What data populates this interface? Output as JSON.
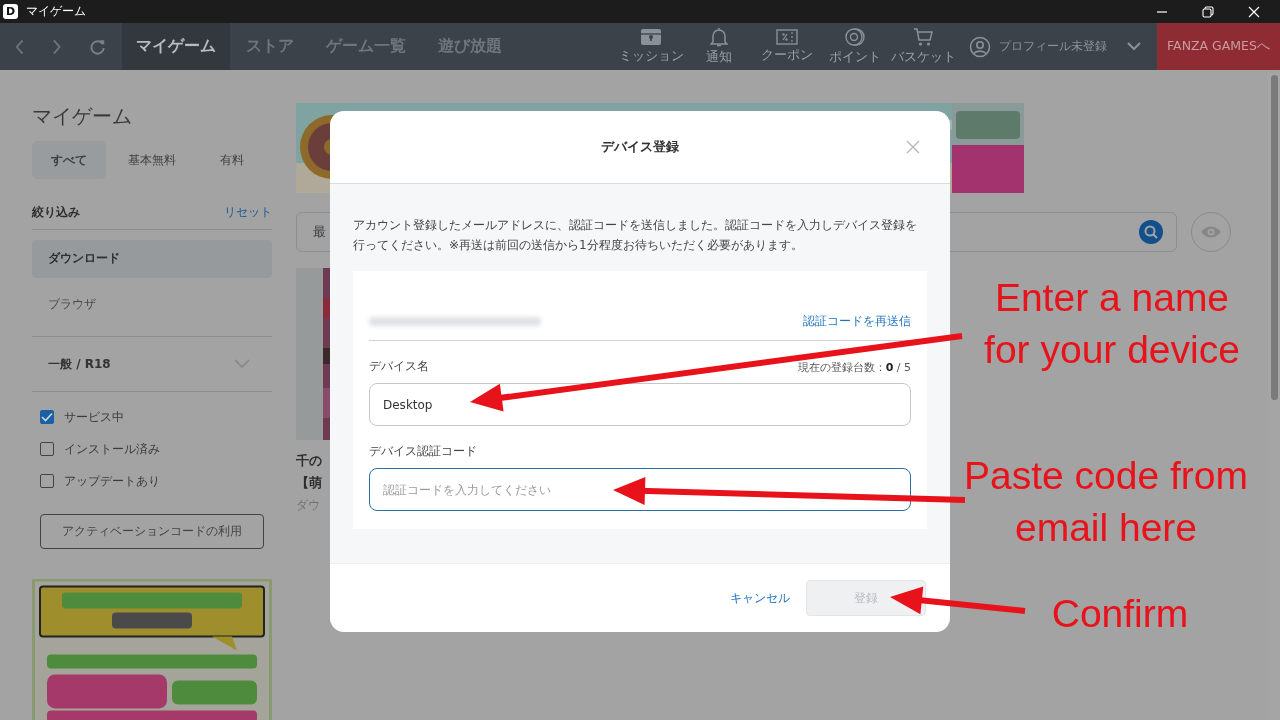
{
  "window": {
    "logo": "D",
    "title": "マイゲーム"
  },
  "nav": {
    "tabs": [
      {
        "label": "マイゲーム",
        "selected": true
      },
      {
        "label": "ストア",
        "selected": false
      },
      {
        "label": "ゲーム一覧",
        "selected": false
      },
      {
        "label": "遊び放題",
        "selected": false
      }
    ],
    "tools": [
      {
        "label": "ミッション",
        "kind": "mission"
      },
      {
        "label": "通知",
        "kind": "bell"
      },
      {
        "label": "クーポン",
        "kind": "coupon"
      },
      {
        "label": "ポイント",
        "kind": "point"
      },
      {
        "label": "バスケット",
        "kind": "cart"
      }
    ],
    "profile": "プロフィール未登録",
    "fanza_button": "FANZA GAMESへ"
  },
  "sidebar": {
    "heading": "マイゲーム",
    "tabs": [
      {
        "label": "すべて",
        "selected": true
      },
      {
        "label": "基本無料",
        "selected": false
      },
      {
        "label": "有料",
        "selected": false
      }
    ],
    "filter": {
      "title": "絞り込み",
      "reset": "リセット"
    },
    "platforms": [
      {
        "label": "ダウンロード",
        "selected": true
      },
      {
        "label": "ブラウザ",
        "selected": false
      }
    ],
    "rating": {
      "label": "一般 / R18",
      "expanded": false
    },
    "checks": [
      {
        "label": "サービス中",
        "checked": true
      },
      {
        "label": "インストール済み",
        "checked": false
      },
      {
        "label": "アップデートあり",
        "checked": false
      }
    ],
    "activation_button": "アクティベーションコードの利用"
  },
  "content": {
    "sort_field": "最",
    "game": {
      "title_lines": [
        "千の",
        "【萌"
      ],
      "status": "ダウ"
    }
  },
  "modal": {
    "title": "デバイス登録",
    "message": "アカウント登録したメールアドレスに、認証コードを送信しました。認証コードを入力しデバイス登録を行ってください。※再送は前回の送信から1分程度お待ちいただく必要があります。",
    "resend": "認証コードを再送信",
    "device_name": {
      "label": "デバイス名",
      "count": "現在の登録台数：**0** / 5",
      "value": "Desktop"
    },
    "code": {
      "label": "デバイス認証コード",
      "placeholder": "認証コードを入力してください",
      "focused": true
    },
    "cancel": "キャンセル",
    "submit": {
      "label": "登録",
      "disabled": true
    }
  },
  "annotations": [
    {
      "text": "Enter a name\nfor your device",
      "kind": "name"
    },
    {
      "text": "Paste code from\nemail here",
      "kind": "code"
    },
    {
      "text": "Confirm",
      "kind": "confirm"
    }
  ]
}
